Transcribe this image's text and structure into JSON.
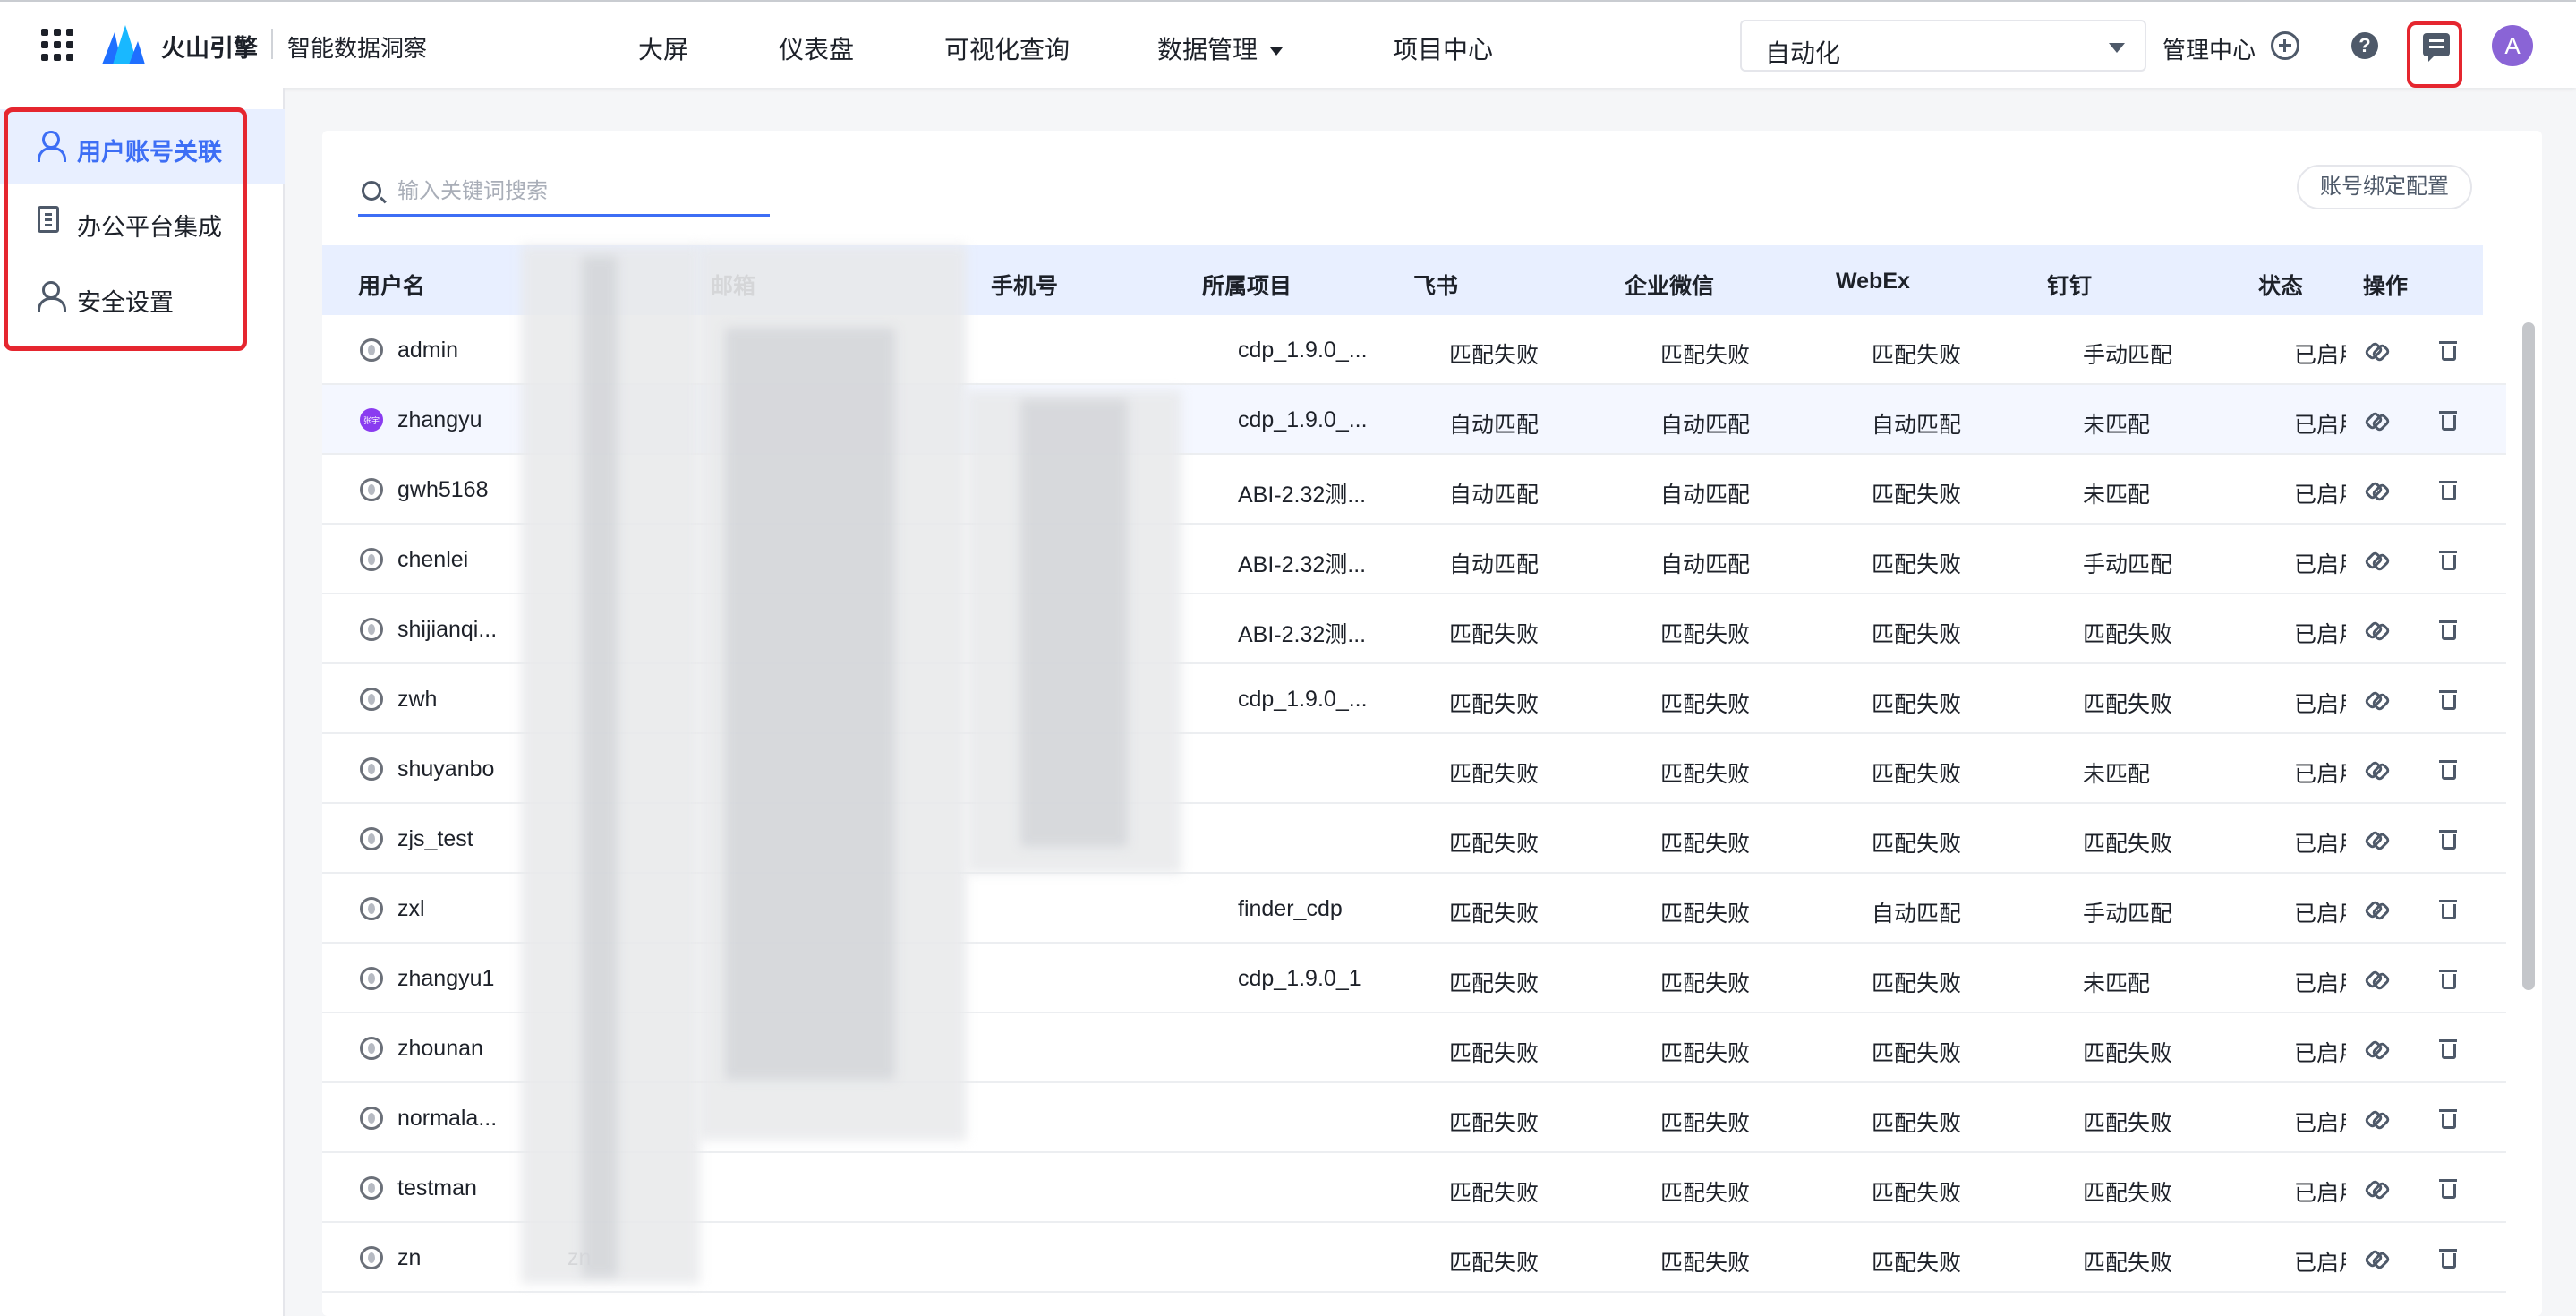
{
  "header": {
    "brand": "火山引擎",
    "product": "智能数据洞察",
    "nav": [
      "大屏",
      "仪表盘",
      "可视化查询",
      "数据管理",
      "项目中心"
    ],
    "project_select": "自动化",
    "management": "管理中心",
    "help_glyph": "?",
    "avatar_letter": "A"
  },
  "sidebar": {
    "items": [
      "用户账号关联",
      "办公平台集成",
      "安全设置"
    ]
  },
  "toolbar": {
    "search_placeholder": "输入关键词搜索",
    "config_button": "账号绑定配置"
  },
  "table": {
    "columns": [
      "用户名",
      "邮箱",
      "手机号",
      "所属项目",
      "飞书",
      "企业微信",
      "WebEx",
      "钉钉",
      "状态",
      "操作"
    ],
    "rows": [
      {
        "user": "admin",
        "email": "",
        "phone": "",
        "project": "cdp_1.9.0_...",
        "feishu": "匹配失败",
        "wecom": "匹配失败",
        "webex": "匹配失败",
        "dingtalk": "手动匹配",
        "status": "已启用"
      },
      {
        "user": "zhangyu",
        "avatar_text": "张宇",
        "email": "",
        "phone": "",
        "project": "cdp_1.9.0_...",
        "feishu": "自动匹配",
        "wecom": "自动匹配",
        "webex": "自动匹配",
        "dingtalk": "未匹配",
        "status": "已启用"
      },
      {
        "user": "gwh5168",
        "email": "",
        "phone": "",
        "project": "ABI-2.32测...",
        "feishu": "自动匹配",
        "wecom": "自动匹配",
        "webex": "匹配失败",
        "dingtalk": "未匹配",
        "status": "已启用"
      },
      {
        "user": "chenlei",
        "email": "",
        "phone": "",
        "project": "ABI-2.32测...",
        "feishu": "自动匹配",
        "wecom": "自动匹配",
        "webex": "匹配失败",
        "dingtalk": "手动匹配",
        "status": "已启用"
      },
      {
        "user": "shijianqi...",
        "email": "",
        "phone": "",
        "project": "ABI-2.32测...",
        "feishu": "匹配失败",
        "wecom": "匹配失败",
        "webex": "匹配失败",
        "dingtalk": "匹配失败",
        "status": "已启用"
      },
      {
        "user": "zwh",
        "email": "",
        "phone": "",
        "project": "cdp_1.9.0_...",
        "feishu": "匹配失败",
        "wecom": "匹配失败",
        "webex": "匹配失败",
        "dingtalk": "匹配失败",
        "status": "已启用"
      },
      {
        "user": "shuyanbo",
        "email": "",
        "phone": "",
        "project": "",
        "feishu": "匹配失败",
        "wecom": "匹配失败",
        "webex": "匹配失败",
        "dingtalk": "未匹配",
        "status": "已启用"
      },
      {
        "user": "zjs_test",
        "email": "",
        "phone": "",
        "project": "",
        "feishu": "匹配失败",
        "wecom": "匹配失败",
        "webex": "匹配失败",
        "dingtalk": "匹配失败",
        "status": "已启用"
      },
      {
        "user": "zxl",
        "email": "",
        "phone": "",
        "project": "finder_cdp",
        "feishu": "匹配失败",
        "wecom": "匹配失败",
        "webex": "自动匹配",
        "dingtalk": "手动匹配",
        "status": "已启用"
      },
      {
        "user": "zhangyu1",
        "email": "",
        "phone": "",
        "project": "cdp_1.9.0_1",
        "feishu": "匹配失败",
        "wecom": "匹配失败",
        "webex": "匹配失败",
        "dingtalk": "未匹配",
        "status": "已启用"
      },
      {
        "user": "zhounan",
        "email": "",
        "phone": "",
        "project": "",
        "feishu": "匹配失败",
        "wecom": "匹配失败",
        "webex": "匹配失败",
        "dingtalk": "匹配失败",
        "status": "已启用"
      },
      {
        "user": "normala...",
        "email": "",
        "phone": "",
        "project": "",
        "feishu": "匹配失败",
        "wecom": "匹配失败",
        "webex": "匹配失败",
        "dingtalk": "匹配失败",
        "status": "已启用"
      },
      {
        "user": "testman",
        "email": "",
        "phone": "",
        "project": "",
        "feishu": "匹配失败",
        "wecom": "匹配失败",
        "webex": "匹配失败",
        "dingtalk": "匹配失败",
        "status": "已启用"
      },
      {
        "user": "zn",
        "email": "zn",
        "phone": "",
        "project": "",
        "feishu": "匹配失败",
        "wecom": "匹配失败",
        "webex": "匹配失败",
        "dingtalk": "匹配失败",
        "status": "已启用"
      }
    ]
  },
  "colors": {
    "accent": "#3d6ef5",
    "highlight_border": "#e5262f",
    "header_row": "#e8efff",
    "avatar": "#8a64d6"
  }
}
